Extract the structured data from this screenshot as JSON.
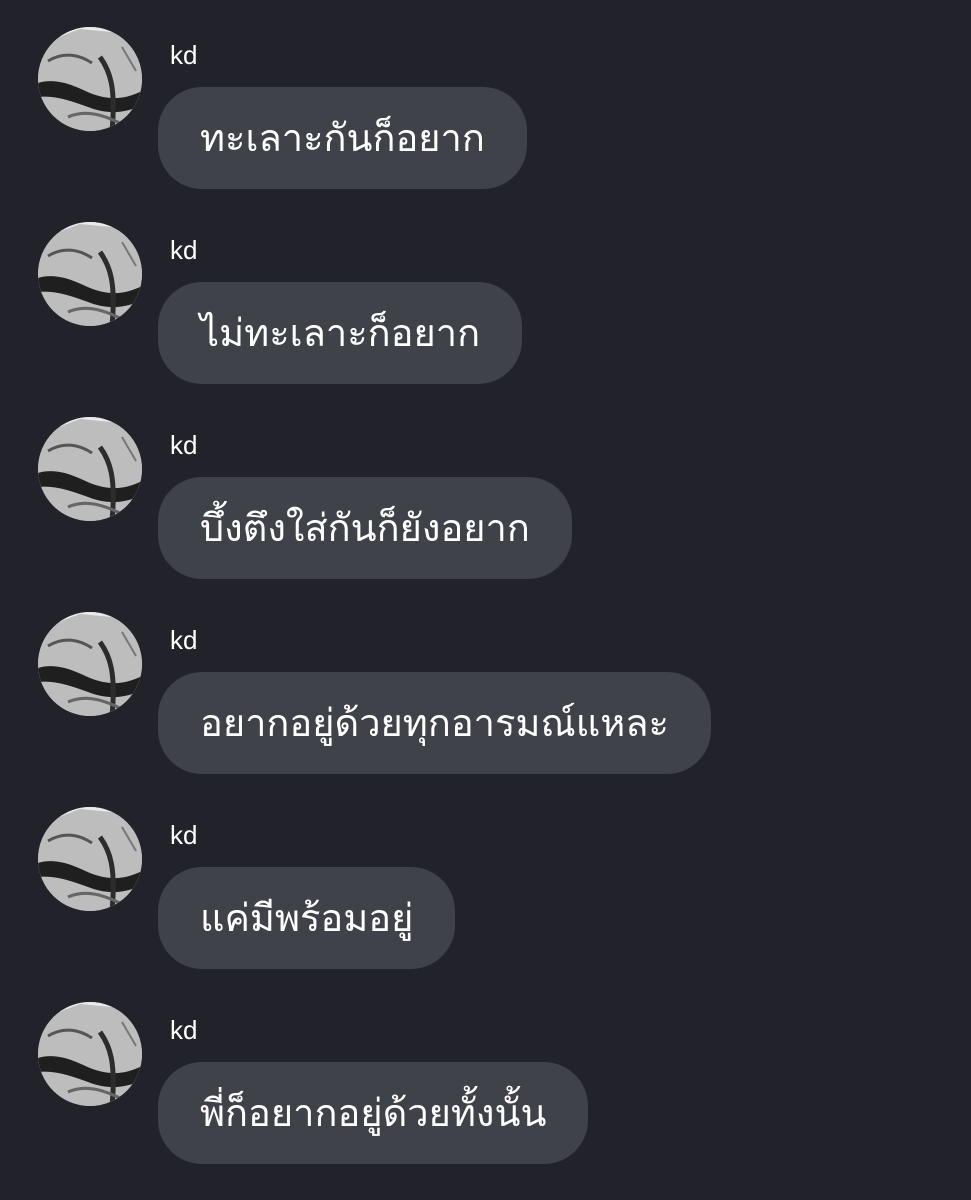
{
  "messages": [
    {
      "sender": "kd",
      "text": "ทะเลาะกันก็อยาก"
    },
    {
      "sender": "kd",
      "text": "ไม่ทะเลาะก็อยาก"
    },
    {
      "sender": "kd",
      "text": "บึ้งตึงใส่กันก็ยังอยาก"
    },
    {
      "sender": "kd",
      "text": "อยากอยู่ด้วยทุกอารมณ์แหละ"
    },
    {
      "sender": "kd",
      "text": "แค่มีพร้อมอยู่"
    },
    {
      "sender": "kd",
      "text": "พี่ก็อยากอยู่ด้วยทั้งนั้น"
    }
  ],
  "colors": {
    "background": "#22232a",
    "bubble": "#404249",
    "text": "#ffffff"
  },
  "icons": {
    "avatar": "user-avatar-image"
  }
}
